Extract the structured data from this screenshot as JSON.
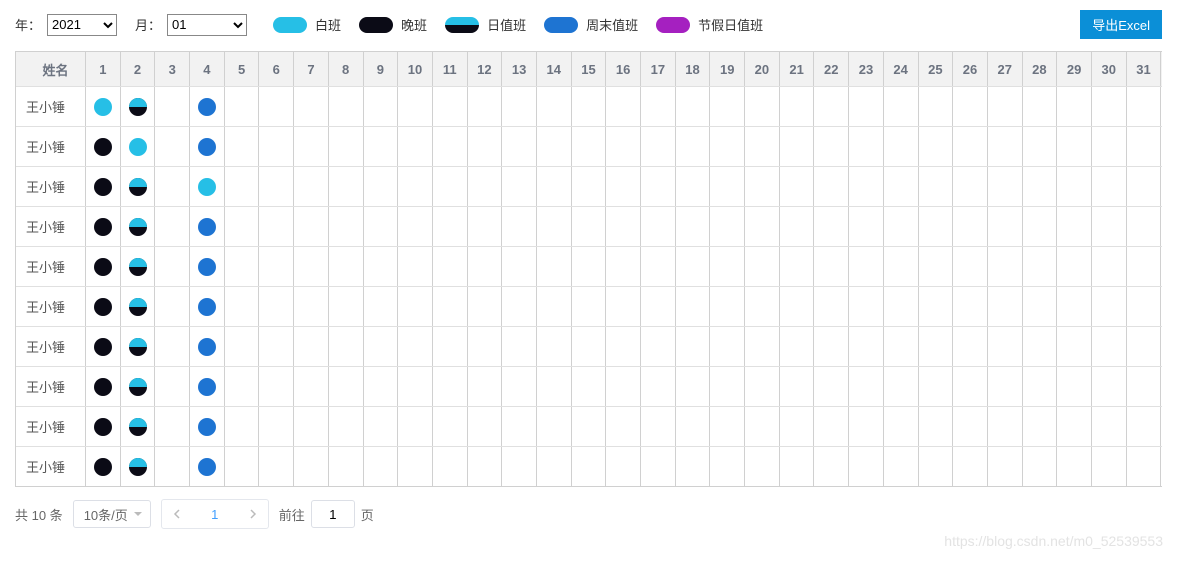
{
  "toolbar": {
    "year_label": "年：",
    "year_value": "2021",
    "month_label": "月：",
    "month_value": "01",
    "export_label": "导出Excel"
  },
  "legend": [
    {
      "label": "白班",
      "color": "#26bfe6"
    },
    {
      "label": "晚班",
      "color": "#0b0b16"
    },
    {
      "label": "日值班",
      "color_top": "#26bfe6",
      "color_bottom": "#0b0b16"
    },
    {
      "label": "周末值班",
      "color": "#1e74d2"
    },
    {
      "label": "节假日值班",
      "color": "#a520c0"
    }
  ],
  "table": {
    "name_header": "姓名",
    "day_headers": [
      "1",
      "2",
      "3",
      "4",
      "5",
      "6",
      "7",
      "8",
      "9",
      "10",
      "11",
      "12",
      "13",
      "14",
      "15",
      "16",
      "17",
      "18",
      "19",
      "20",
      "21",
      "22",
      "23",
      "24",
      "25",
      "26",
      "27",
      "28",
      "29",
      "30",
      "31"
    ],
    "rows": [
      {
        "name": "王小锤",
        "shifts": {
          "1": "day",
          "2": "dual",
          "4": "weekend"
        }
      },
      {
        "name": "王小锤",
        "shifts": {
          "1": "night",
          "2": "day",
          "4": "weekend"
        }
      },
      {
        "name": "王小锤",
        "shifts": {
          "1": "night",
          "2": "dual",
          "4": "day"
        }
      },
      {
        "name": "王小锤",
        "shifts": {
          "1": "night",
          "2": "dual",
          "4": "weekend"
        }
      },
      {
        "name": "王小锤",
        "shifts": {
          "1": "night",
          "2": "dual",
          "4": "weekend"
        }
      },
      {
        "name": "王小锤",
        "shifts": {
          "1": "night",
          "2": "dual",
          "4": "weekend"
        }
      },
      {
        "name": "王小锤",
        "shifts": {
          "1": "night",
          "2": "dual",
          "4": "weekend"
        }
      },
      {
        "name": "王小锤",
        "shifts": {
          "1": "night",
          "2": "dual",
          "4": "weekend"
        }
      },
      {
        "name": "王小锤",
        "shifts": {
          "1": "night",
          "2": "dual",
          "4": "weekend"
        }
      },
      {
        "name": "王小锤",
        "shifts": {
          "1": "night",
          "2": "dual",
          "4": "weekend"
        }
      }
    ]
  },
  "pagination": {
    "total_text": "共 10 条",
    "page_size_label": "10条/页",
    "current_page": "1",
    "jump_prefix": "前往",
    "jump_value": "1",
    "jump_suffix": "页"
  },
  "watermark": "https://blog.csdn.net/m0_52539553",
  "shift_classes": {
    "day": "day-shift",
    "night": "night-shift",
    "dual": "dual",
    "weekend": "weekend",
    "holiday": "holiday"
  }
}
